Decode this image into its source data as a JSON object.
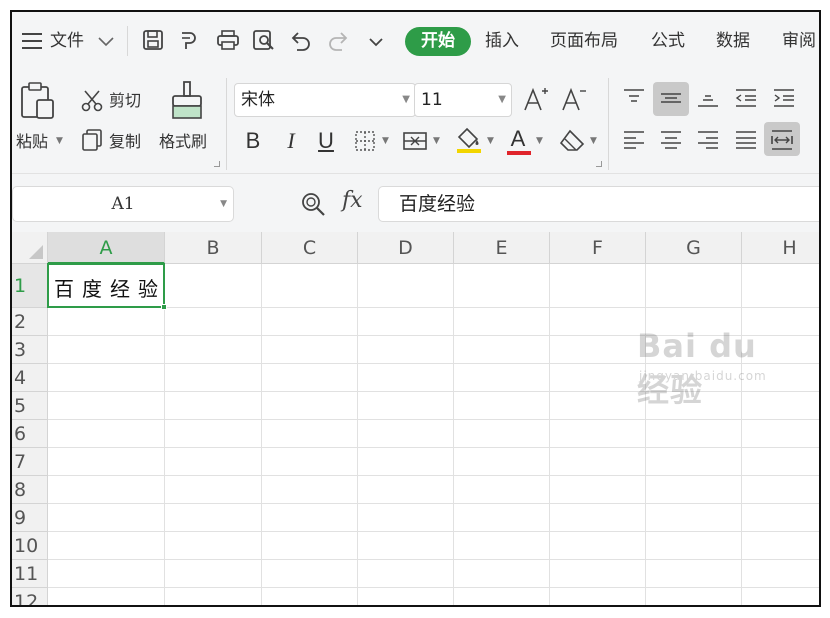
{
  "menu": {
    "file_label": "文件",
    "tabs": [
      {
        "label": "开始",
        "active": true
      },
      {
        "label": "插入"
      },
      {
        "label": "页面布局"
      },
      {
        "label": "公式"
      },
      {
        "label": "数据"
      },
      {
        "label": "审阅"
      }
    ]
  },
  "ribbon": {
    "cut_label": "剪切",
    "paste_label": "粘贴",
    "copy_label": "复制",
    "format_painter_label": "格式刷",
    "font_name": "宋体",
    "font_size": "11",
    "bold_label": "B",
    "italic_label": "I",
    "underline_label": "U",
    "font_color_label": "A",
    "font_color": "#e0242b",
    "fill_color": "#f2d500"
  },
  "formula_bar": {
    "cell_ref": "A1",
    "fx_label": "fx",
    "content": "百度经验"
  },
  "sheet": {
    "columns": [
      "A",
      "B",
      "C",
      "D",
      "E",
      "F",
      "G",
      "H"
    ],
    "rows": [
      "1",
      "2",
      "3",
      "4",
      "5",
      "6",
      "7",
      "8",
      "9",
      "10",
      "11",
      "12"
    ],
    "a1_value": "百度经验",
    "selected_cell": "A1"
  },
  "watermark": {
    "main": "Bai du 经验",
    "sub": "jingyan.baidu.com"
  },
  "colors": {
    "accent": "#2e9c48",
    "toolbar_bg": "#f4f5f6"
  }
}
